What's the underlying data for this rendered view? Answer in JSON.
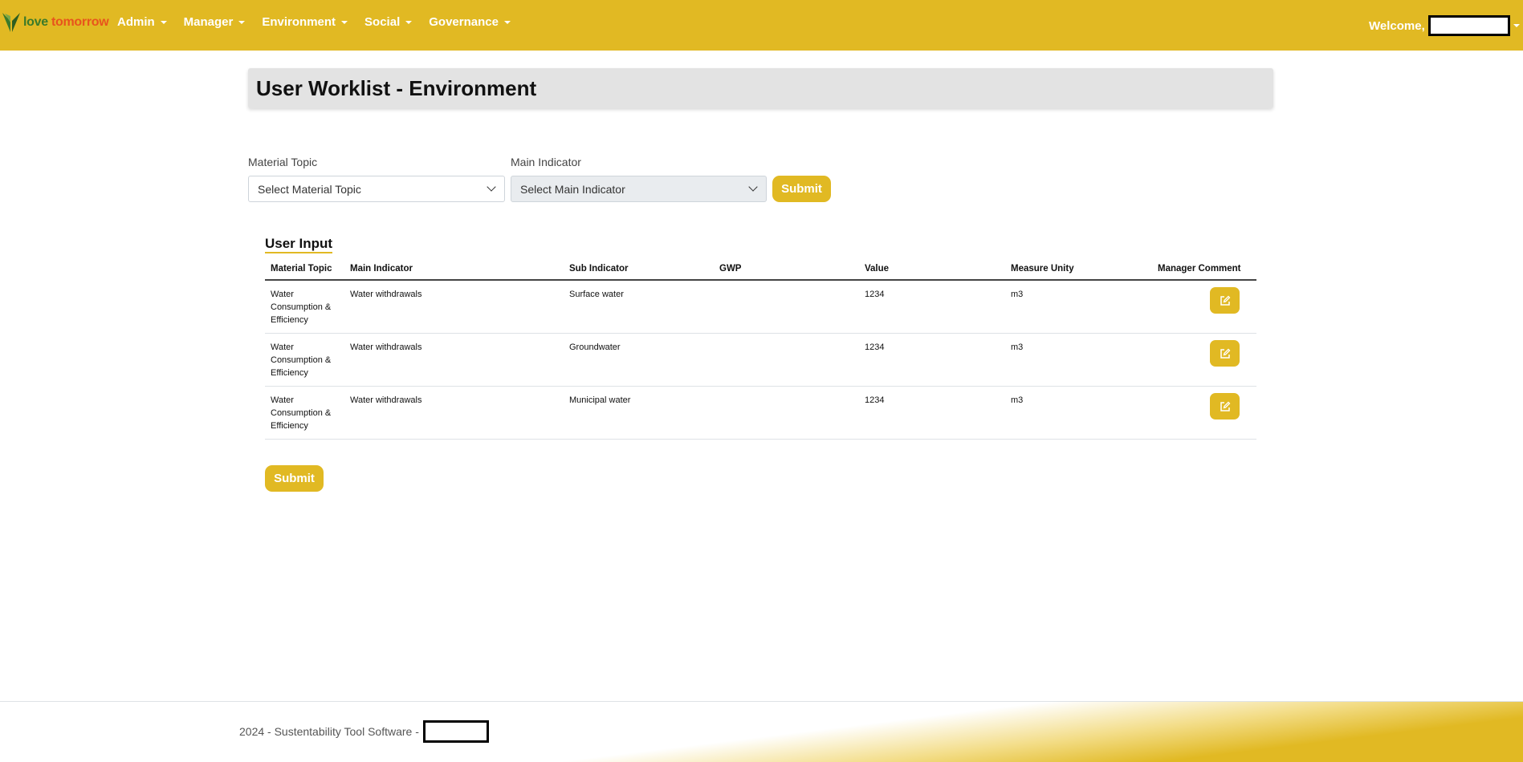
{
  "brand": {
    "love": "love",
    "tomorrow": "tomorrow"
  },
  "nav": {
    "items": [
      {
        "label": "Admin"
      },
      {
        "label": "Manager"
      },
      {
        "label": "Environment"
      },
      {
        "label": "Social"
      },
      {
        "label": "Governance"
      }
    ],
    "welcome": "Welcome,"
  },
  "page": {
    "title": "User Worklist - Environment"
  },
  "filters": {
    "material_topic_label": "Material Topic",
    "material_topic_value": "Select Material Topic",
    "main_indicator_label": "Main Indicator",
    "main_indicator_value": "Select Main Indicator",
    "submit_label": "Submit"
  },
  "section": {
    "title": "User Input"
  },
  "table": {
    "headers": {
      "material_topic": "Material Topic",
      "main_indicator": "Main Indicator",
      "sub_indicator": "Sub Indicator",
      "gwp": "GWP",
      "value": "Value",
      "measure_unity": "Measure Unity",
      "manager_comment": "Manager Comment"
    },
    "rows": [
      {
        "material_topic": "Water Consumption & Efficiency",
        "main_indicator": "Water withdrawals",
        "sub_indicator": "Surface water",
        "gwp": "",
        "value": "1234",
        "measure_unity": "m3"
      },
      {
        "material_topic": "Water Consumption & Efficiency",
        "main_indicator": "Water withdrawals",
        "sub_indicator": "Groundwater",
        "gwp": "",
        "value": "1234",
        "measure_unity": "m3"
      },
      {
        "material_topic": "Water Consumption & Efficiency",
        "main_indicator": "Water withdrawals",
        "sub_indicator": "Municipal water",
        "gwp": "",
        "value": "1234",
        "measure_unity": "m3"
      }
    ]
  },
  "bottom_submit_label": "Submit",
  "footer": {
    "text": "2024 - Sustentability Tool Software -"
  },
  "colors": {
    "accent": "#e1b923",
    "brand_green": "#3b7a2a",
    "brand_orange": "#e8541c"
  }
}
